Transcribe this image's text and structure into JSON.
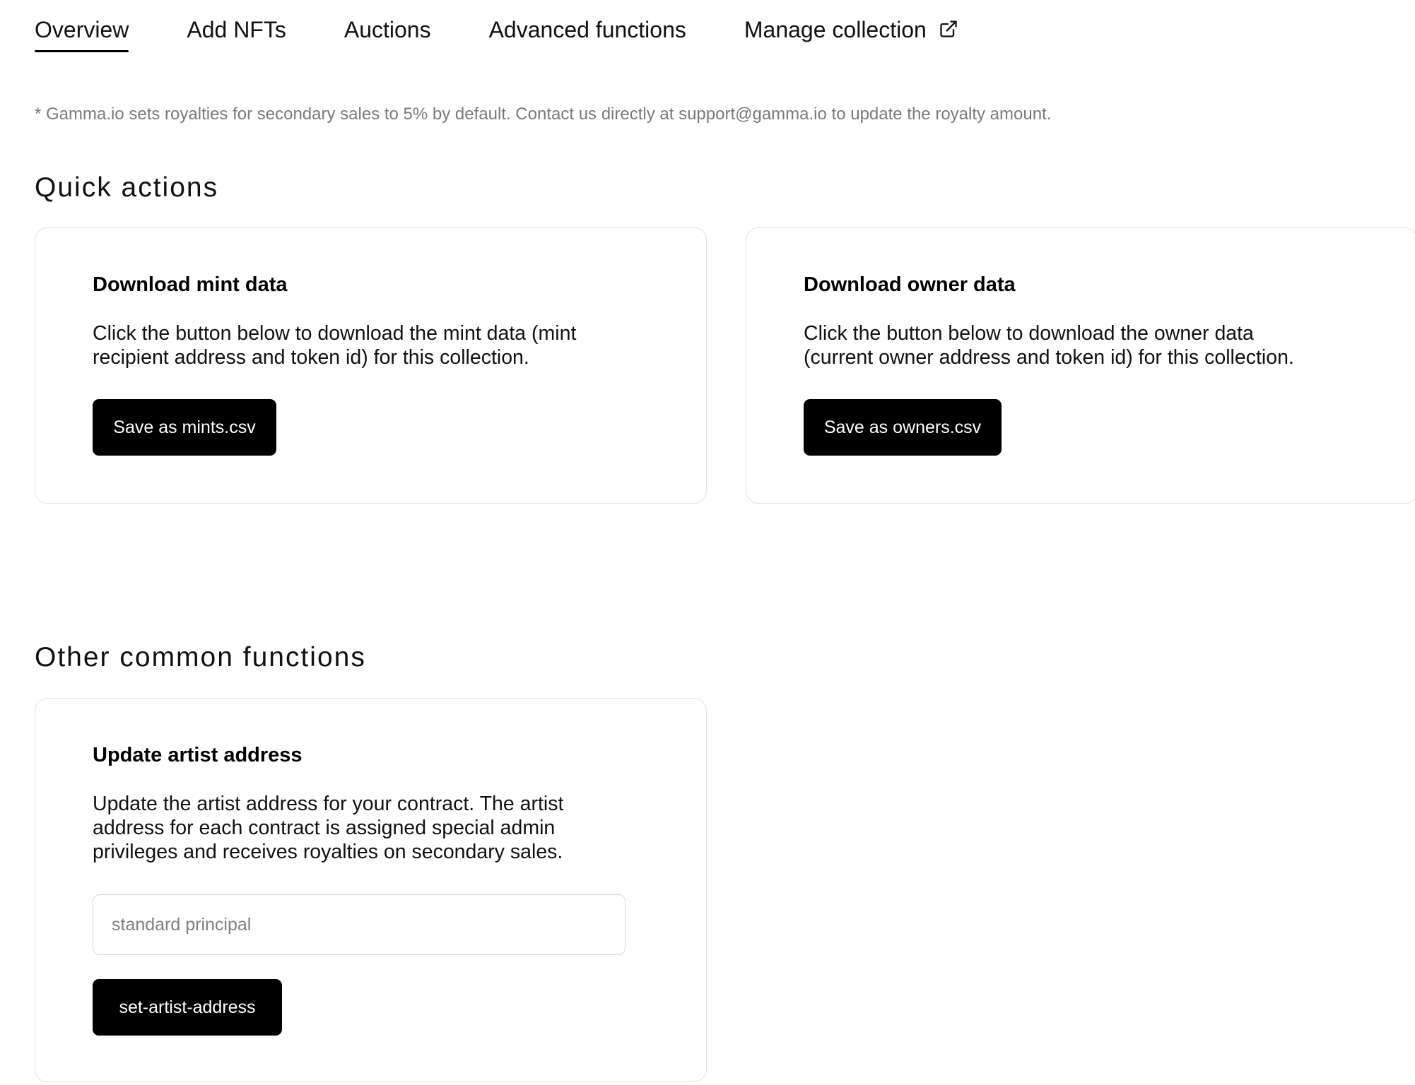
{
  "tabs": [
    {
      "label": "Overview",
      "active": true
    },
    {
      "label": "Add NFTs",
      "active": false
    },
    {
      "label": "Auctions",
      "active": false
    },
    {
      "label": "Advanced functions",
      "active": false
    },
    {
      "label": "Manage collection",
      "active": false,
      "icon": "external-link-icon"
    }
  ],
  "note": "* Gamma.io sets royalties for secondary sales to 5% by default. Contact us directly at support@gamma.io to update the royalty amount.",
  "quick_actions": {
    "title": "Quick actions",
    "cards": [
      {
        "title": "Download mint data",
        "description_lines": [
          "Click the button below to download the mint data (mint",
          "recipient address and token id) for this collection."
        ],
        "button_label": "Save as mints.csv"
      },
      {
        "title": "Download owner data",
        "description_lines": [
          "Click the button below to download the owner data",
          "(current owner address and token id) for this collection."
        ],
        "button_label": "Save as owners.csv"
      }
    ]
  },
  "other_functions": {
    "title": "Other common functions",
    "cards": [
      {
        "title": "Update artist address",
        "description_lines": [
          "Update the artist address for your contract. The artist",
          "address for each contract is assigned special admin",
          "privileges and receives royalties on secondary sales."
        ],
        "input_placeholder": "standard principal",
        "input_value": "",
        "button_label": "set-artist-address"
      }
    ]
  },
  "colors": {
    "button_bg": "#000000",
    "button_text": "#ffffff",
    "note_text": "#7a7a7a",
    "card_border": "#e3e3e3"
  }
}
